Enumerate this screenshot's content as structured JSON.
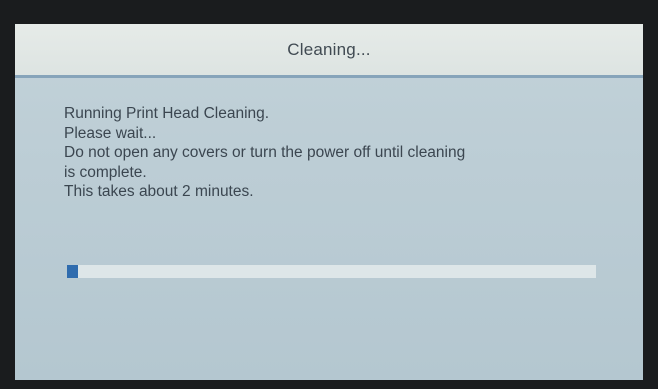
{
  "dialog": {
    "title": "Cleaning...",
    "message_lines": [
      "Running Print Head Cleaning.",
      "Please wait...",
      "Do not open any covers or turn the power off until cleaning",
      "is complete.",
      "This takes about 2 minutes."
    ],
    "progress_percent": 2
  },
  "colors": {
    "title_bar_background": "#e2e8e6",
    "title_bar_border": "#87a4ba",
    "screen_background": "#bfd0d7",
    "text": "#3b4650",
    "progress_fill": "#2f6cae",
    "progress_track": "#dde6e8"
  }
}
